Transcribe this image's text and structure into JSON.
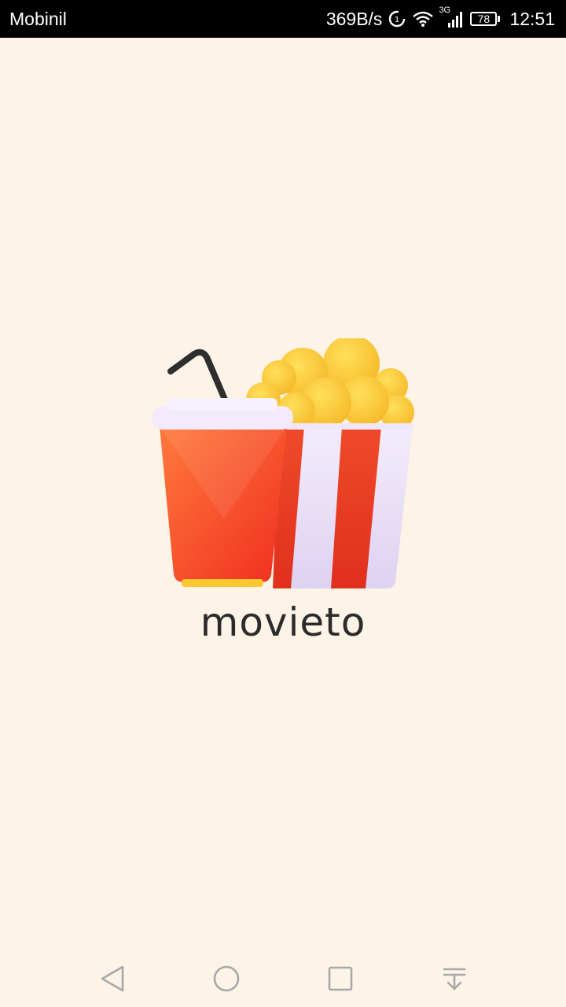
{
  "status_bar": {
    "carrier": "Mobinil",
    "net_speed": "369B/s",
    "network_type": "3G",
    "battery_level": "78",
    "time": "12:51",
    "icons": [
      "data-saver-icon",
      "wifi-icon",
      "signal-icon",
      "battery-icon"
    ]
  },
  "splash": {
    "app_name": "movieto",
    "logo_icon": "popcorn-and-drink-icon"
  },
  "nav_bar": {
    "icons": [
      "back-icon",
      "home-icon",
      "recents-icon",
      "notification-pull-icon"
    ]
  },
  "colors": {
    "background": "#fdf3e7",
    "status_bar": "#000000",
    "cup_red": "#f2462b",
    "popcorn_yellow": "#fdd23f",
    "text_dark": "#2b2b2b"
  }
}
